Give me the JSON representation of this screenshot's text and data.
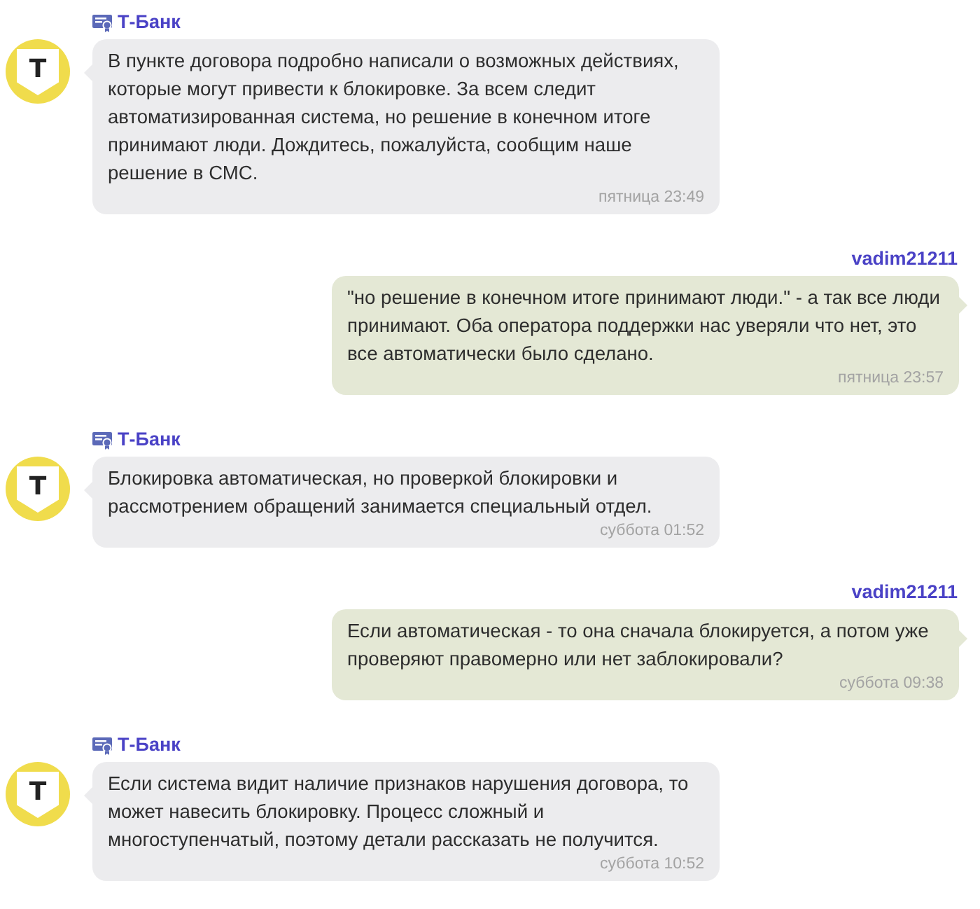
{
  "messages": [
    {
      "kind": "bank",
      "sender": "Т-Банк",
      "verified": true,
      "logo_letter": "Т",
      "text": "В пункте договора подробно написали о возможных действиях,\nкоторые могут привести к блокировке. За всем следит\nавтоматизированная система, но решение в конечном итоге\nпринимают люди. Дождитесь, пожалуйста, сообщим наше\nрешение в СМС.",
      "time": "пятница 23:49"
    },
    {
      "kind": "user",
      "sender": "vadim21211",
      "verified": false,
      "text": "\"но решение в конечном итоге принимают люди.\" - а так все люди\nпринимают. Оба оператора поддержки нас уверяли что нет, это\nвсе автоматически было сделано.",
      "time": "пятница 23:57"
    },
    {
      "kind": "bank",
      "sender": "Т-Банк",
      "verified": true,
      "logo_letter": "Т",
      "text": "Блокировка автоматическая, но проверкой блокировки и\nрассмотрением обращений занимается специальный отдел.",
      "time": "суббота 01:52"
    },
    {
      "kind": "user",
      "sender": "vadim21211",
      "verified": false,
      "text": "Если автоматическая - то она сначала блокируется, а потом уже\nпроверяют правомерно или нет заблокировали?",
      "time": "суббота 09:38"
    },
    {
      "kind": "bank",
      "sender": "Т-Банк",
      "verified": true,
      "logo_letter": "Т",
      "text": "Если система видит наличие признаков нарушения договора, то\nможет навесить блокировку. Процесс сложный и\nмногоступенчатый, поэтому детали рассказать не получится.",
      "time": "суббота 10:52"
    }
  ]
}
